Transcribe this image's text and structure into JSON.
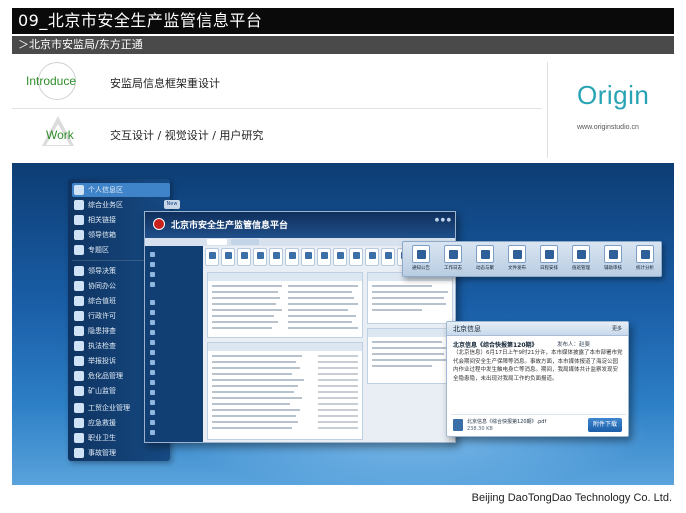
{
  "header": {
    "title": "09_北京市安全生产监管信息平台",
    "subtitle": "＞北京市安监局/东方正通"
  },
  "intro": {
    "introduce_label": "Introduce",
    "introduce_text": "安监局信息框架重设计",
    "work_label": "Work",
    "work_text": "交互设计 / 视觉设计 / 用户研究"
  },
  "brand": {
    "logo": "Origin",
    "url": "www.originstudio.cn",
    "logo_color": "#27a3b4",
    "accent_green": "#2f8e2a"
  },
  "menu": {
    "items": [
      {
        "label": "个人信息区",
        "icon": "book-icon"
      },
      {
        "label": "综合业务区",
        "icon": "grid-icon",
        "badge": "New"
      },
      {
        "label": "相关链接",
        "icon": "org-icon"
      },
      {
        "label": "领导信箱",
        "icon": "user-icon"
      },
      {
        "label": "专题区",
        "icon": "folder-icon"
      },
      {
        "label": "领导决策",
        "icon": "chart-icon"
      },
      {
        "label": "协同办公",
        "icon": "people-icon"
      },
      {
        "label": "综合值班",
        "icon": "clock-icon"
      },
      {
        "label": "行政许可",
        "icon": "check-icon"
      },
      {
        "label": "隐患排查",
        "icon": "warning-icon"
      },
      {
        "label": "执法检查",
        "icon": "hammer-icon"
      },
      {
        "label": "举报投诉",
        "icon": "phone-icon"
      },
      {
        "label": "危化品管理",
        "icon": "flask-icon"
      },
      {
        "label": "矿山监管",
        "icon": "mine-icon"
      },
      {
        "label": "工贸企业管理",
        "icon": "factory-icon"
      },
      {
        "label": "应急救援",
        "icon": "first-aid-icon"
      },
      {
        "label": "职业卫生",
        "icon": "shield-icon"
      },
      {
        "label": "事故管理",
        "icon": "car-icon"
      }
    ]
  },
  "window": {
    "title": "北京市安全生产监管信息平台"
  },
  "iconbar": {
    "items": [
      "通知公告",
      "工作日志",
      "动态与聚",
      "文件发布",
      "日程安排",
      "值班管理",
      "辅助审核",
      "统计分析"
    ]
  },
  "news": {
    "head": "北京信息",
    "more": "更多",
    "title": "北京信息《综合快报第120期》",
    "publisher": "发布人：赵斐",
    "body": "（北京信息）6月17日上午9时21分许，本市媒体披露了本市部署市党代会期间安全生产保障等消息。事故方面，本市媒体报道了海淀公园内作业过程中发生触电身亡等消息。期间，我局媒体共计监察发现安全隐患隐，未出现对我局工作的负面报道。",
    "file_name": "北京信息《综合快报第120期》.pdf",
    "file_size": "238.30 KB",
    "download": "附件下载"
  },
  "footer": {
    "company": "Beijing DaoTongDao Technology Co. Ltd."
  }
}
